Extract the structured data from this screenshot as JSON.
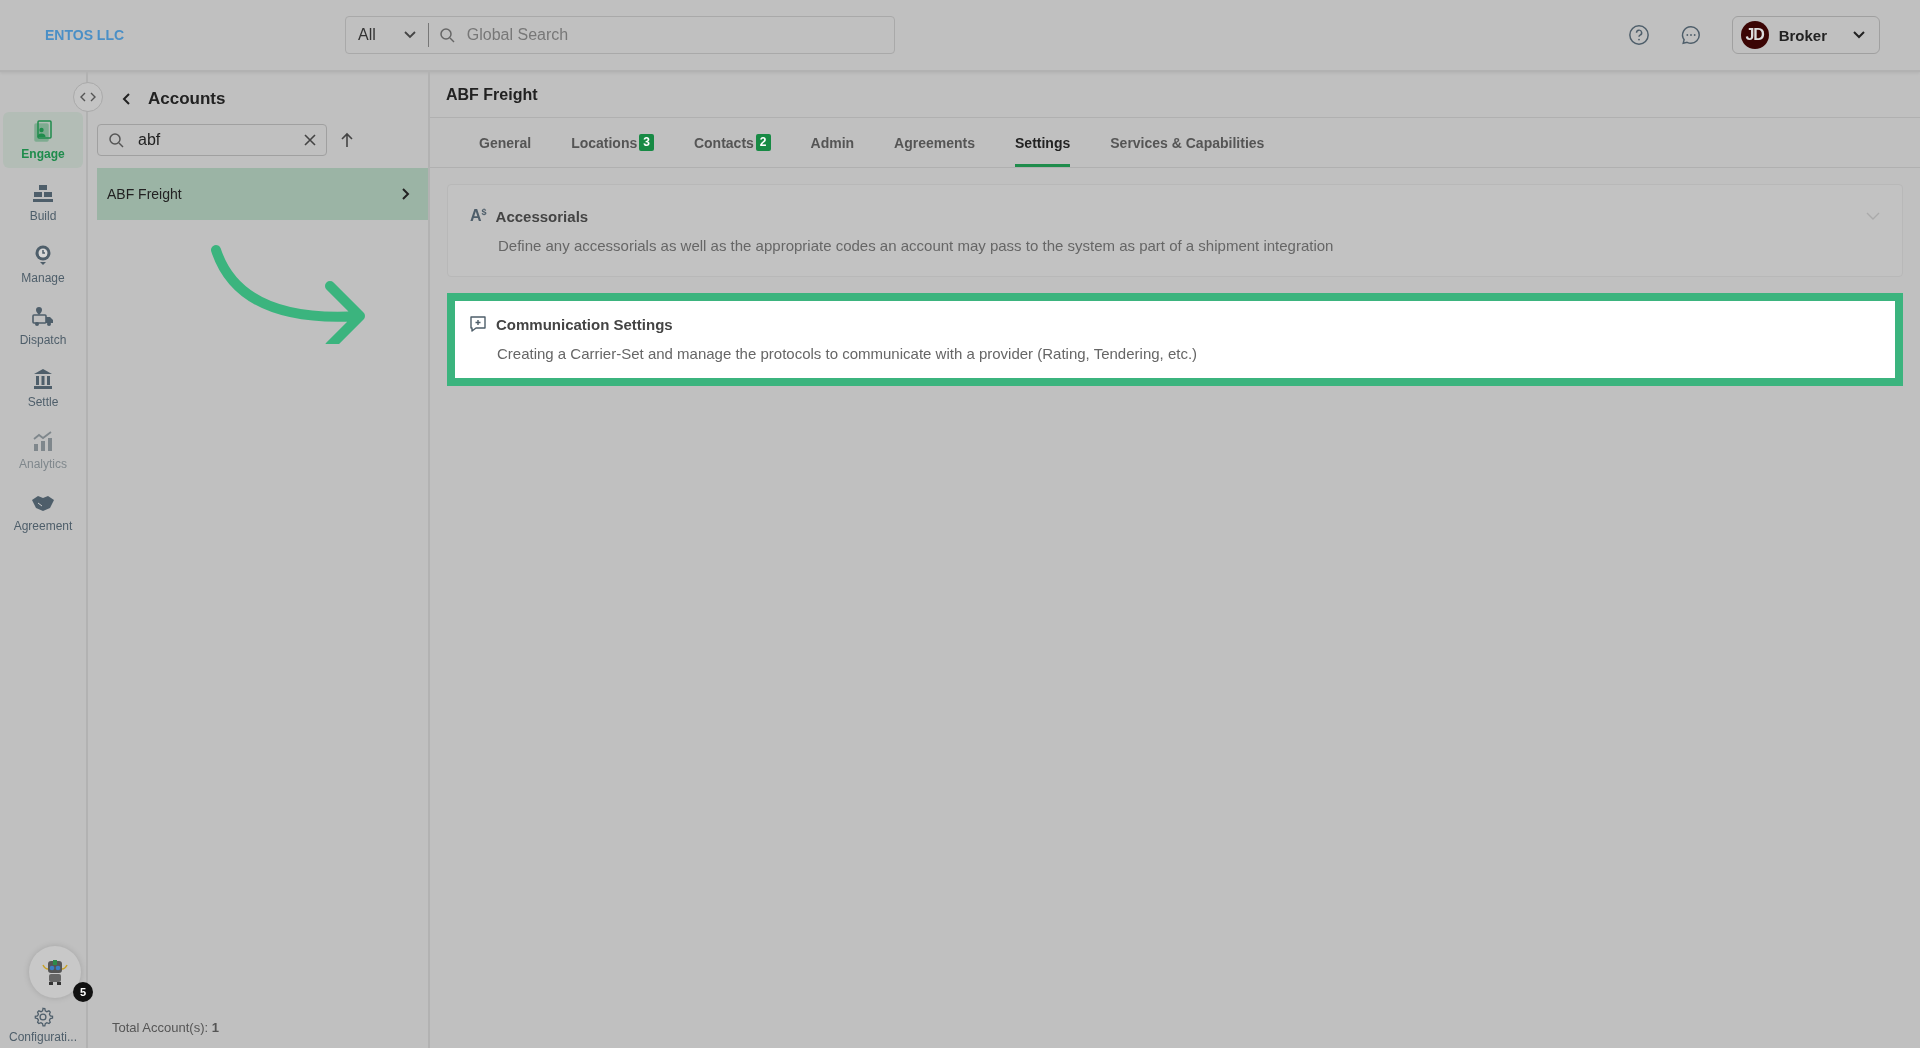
{
  "company": "ENTOS LLC",
  "search": {
    "scope": "All",
    "placeholder": "Global Search"
  },
  "user": {
    "initials": "JD",
    "role": "Broker"
  },
  "nav": [
    {
      "kind": "engage",
      "label": "Engage",
      "selected": true,
      "disabled": false
    },
    {
      "kind": "build",
      "label": "Build",
      "selected": false,
      "disabled": false
    },
    {
      "kind": "manage",
      "label": "Manage",
      "selected": false,
      "disabled": false
    },
    {
      "kind": "dispatch",
      "label": "Dispatch",
      "selected": false,
      "disabled": false
    },
    {
      "kind": "settle",
      "label": "Settle",
      "selected": false,
      "disabled": false
    },
    {
      "kind": "analytics",
      "label": "Analytics",
      "selected": false,
      "disabled": true
    },
    {
      "kind": "agreement",
      "label": "Agreement",
      "selected": false,
      "disabled": false
    }
  ],
  "config": {
    "label": "Configurati...",
    "badge": "5"
  },
  "accounts": {
    "title": "Accounts",
    "search_value": "abf",
    "items": [
      {
        "label": "ABF Freight",
        "selected": true
      }
    ],
    "total_label": "Total Account(s):",
    "total": "1"
  },
  "detail": {
    "title": "ABF Freight",
    "tabs": [
      {
        "label": "General",
        "selected": false
      },
      {
        "label": "Locations",
        "badge": "3",
        "selected": false
      },
      {
        "label": "Contacts",
        "badge": "2",
        "selected": false
      },
      {
        "label": "Admin",
        "selected": false
      },
      {
        "label": "Agreements",
        "selected": false
      },
      {
        "label": "Settings",
        "selected": true
      },
      {
        "label": "Services & Capabilities",
        "selected": false
      }
    ],
    "sections": [
      {
        "kind": "accessorials",
        "symbol": "A",
        "symbol_sup": "$",
        "title": "Accessorials",
        "description": "Define any accessorials as well as the appropriate codes an account may pass to the system as part of a shipment integration",
        "highlighted": false
      },
      {
        "kind": "communication",
        "title": "Communication Settings",
        "description": "Creating a Carrier-Set and manage the protocols to communicate with a provider (Rating, Tendering, etc.)",
        "highlighted": true
      }
    ]
  }
}
